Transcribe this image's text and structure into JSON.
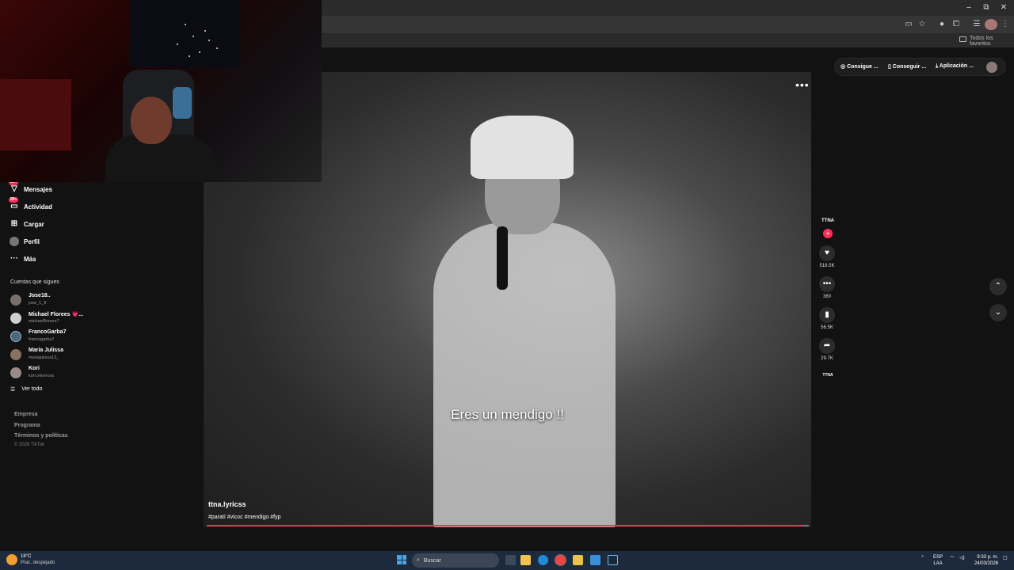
{
  "browser": {
    "window_controls": [
      "–",
      "⧉",
      "✕"
    ],
    "bookmarks_label": "Todos los favoritos"
  },
  "sidebar": {
    "nav": [
      {
        "label": "Mensajes",
        "icon": "messages-icon",
        "badge": "99+"
      },
      {
        "label": "Actividad",
        "icon": "activity-icon",
        "badge": "99+"
      },
      {
        "label": "Cargar",
        "icon": "upload-icon",
        "badge": ""
      },
      {
        "label": "Perfil",
        "icon": "profile-icon",
        "badge": ""
      },
      {
        "label": "Más",
        "icon": "more-icon",
        "badge": ""
      }
    ],
    "following_title": "Cuentas que sigues",
    "accounts": [
      {
        "name": "Jose18..",
        "handle": "jose_1_8"
      },
      {
        "name": "Michael Florees 💗...",
        "handle": "michaelflorees7"
      },
      {
        "name": "FrancoGarba7",
        "handle": "francogarba7"
      },
      {
        "name": "Maria Julissa",
        "handle": "mariajulissa13_"
      },
      {
        "name": "Kori",
        "handle": "kori.oliveross"
      }
    ],
    "see_all": "Ver todo",
    "footer": [
      "Empresa",
      "Programa",
      "Términos y políticas"
    ],
    "copyright": "© 2026 TikTok"
  },
  "top_actions": {
    "coins": "Consigue ...",
    "get_app": "Conseguir ...",
    "application": "Aplicación ..."
  },
  "video": {
    "caption": "Eres un mendigo !!",
    "author": "ttna.lyricss",
    "hashtags": "#paratí #vicoc #mendigo #fyp",
    "progress": 0.99
  },
  "actions": {
    "author_short": "TTNA",
    "likes": "518.5K",
    "comments": "360",
    "saves": "56.5K",
    "shares": "29.7K",
    "music": "TTNA"
  },
  "taskbar": {
    "temperature": "18°C",
    "weather": "Prac. despejado",
    "search_placeholder": "Buscar",
    "lang_top": "ESP",
    "lang_bottom": "LAA",
    "time": "9:33 p. m.",
    "date": "24/03/2026"
  },
  "colors": {
    "accent": "#fe2c55",
    "background": "#121212",
    "taskbar": "#1d2a3d"
  }
}
